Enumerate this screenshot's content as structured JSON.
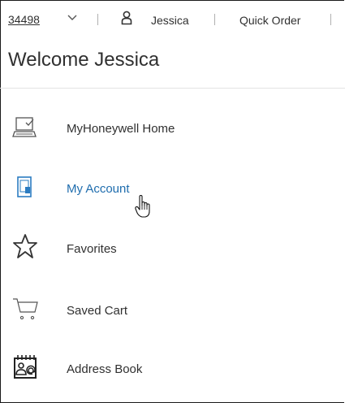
{
  "header": {
    "account_number": "34498",
    "user_name": "Jessica",
    "quick_order_label": "Quick Order"
  },
  "welcome_text": "Welcome Jessica",
  "menu": {
    "items": [
      {
        "label": "MyHoneywell Home",
        "icon": "laptop-check-icon",
        "active": false
      },
      {
        "label": "My Account",
        "icon": "tablet-user-icon",
        "active": true
      },
      {
        "label": "Favorites",
        "icon": "star-icon",
        "active": false
      },
      {
        "label": "Saved Cart",
        "icon": "cart-icon",
        "active": false
      },
      {
        "label": "Address Book",
        "icon": "address-book-icon",
        "active": false
      }
    ]
  },
  "colors": {
    "text": "#303030",
    "active_link": "#1f6dae",
    "icon_blue": "#2b7cc1"
  }
}
